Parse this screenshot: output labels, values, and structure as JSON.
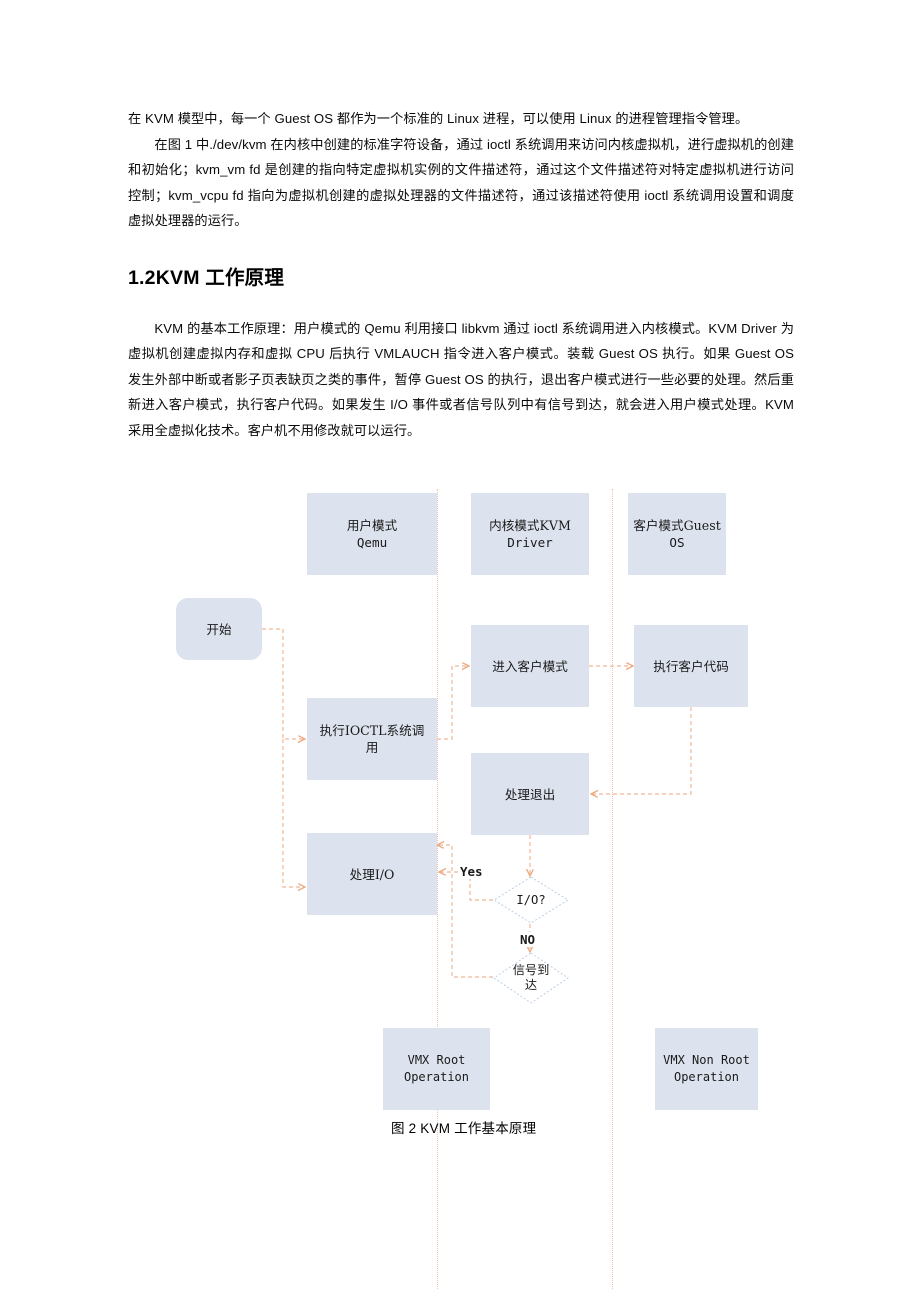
{
  "document": {
    "paragraphs": [
      "在 KVM 模型中，每一个 Guest OS  都作为一个标准的 Linux 进程，可以使用 Linux 的进程管理指令管理。",
      "在图 1 中./dev/kvm 在内核中创建的标准字符设备，通过 ioctl 系统调用来访问内核虚拟机，进行虚拟机的创建和初始化；kvm_vm fd 是创建的指向特定虚拟机实例的文件描述符，通过这个文件描述符对特定虚拟机进行访问控制；kvm_vcpu fd 指向为虚拟机创建的虚拟处理器的文件描述符，通过该描述符使用 ioctl 系统调用设置和调度虚拟处理器的运行。"
    ],
    "heading": "1.2KVM 工作原理",
    "body_after_heading": "KVM 的基本工作原理：用户模式的 Qemu 利用接口 libkvm 通过 ioctl 系统调用进入内核模式。KVM Driver 为虚拟机创建虚拟内存和虚拟 CPU 后执行 VMLAUCH 指令进入客户模式。装载 Guest OS 执行。如果 Guest OS 发生外部中断或者影子页表缺页之类的事件，暂停 Guest OS 的执行，退出客户模式进行一些必要的处理。然后重新进入客户模式，执行客户代码。如果发生 I/O 事件或者信号队列中有信号到达，就会进入用户模式处理。KVM 采用全虚拟化技术。客户机不用修改就可以运行。",
    "figure_caption": "图 2 KVM  工作基本原理"
  },
  "figure": {
    "colors": {
      "node_fill": "#dde3ee",
      "connector": "#f0b896",
      "lane_divider": "#e8b9a0",
      "diamond_stroke": "#bcd0e6",
      "text": "#1a1a1a"
    },
    "nodes": [
      {
        "id": "user-mode-qemu",
        "line1": "用户模式",
        "line2": "Qemu"
      },
      {
        "id": "kernel-mode-kvm",
        "line1": "内核模式KVM",
        "line2": "Driver"
      },
      {
        "id": "guest-mode-guest-os",
        "line1": "客户模式Guest",
        "line2": "OS"
      },
      {
        "id": "start",
        "line1": "开始",
        "line2": ""
      },
      {
        "id": "exec-ioctl",
        "line1": "执行IOCTL系统调",
        "line2": "用"
      },
      {
        "id": "enter-guest-mode",
        "line1": "进入客户模式",
        "line2": ""
      },
      {
        "id": "exec-guest-code",
        "line1": "执行客户代码",
        "line2": ""
      },
      {
        "id": "handle-exit",
        "line1": "处理退出",
        "line2": ""
      },
      {
        "id": "handle-io",
        "line1": "处理I/O",
        "line2": ""
      },
      {
        "id": "vmx-root",
        "line1": "VMX Root",
        "line2": "Operation"
      },
      {
        "id": "vmx-non-root",
        "line1": "VMX Non Root",
        "line2": "Operation"
      }
    ],
    "decisions": [
      {
        "id": "io-decision",
        "line1": "I/O?",
        "line2": ""
      },
      {
        "id": "signal-arrival",
        "line1": "信号到",
        "line2": "达"
      }
    ],
    "edge_labels": [
      {
        "id": "yes-label",
        "text": "Yes"
      },
      {
        "id": "no-label",
        "text": "NO"
      }
    ]
  }
}
